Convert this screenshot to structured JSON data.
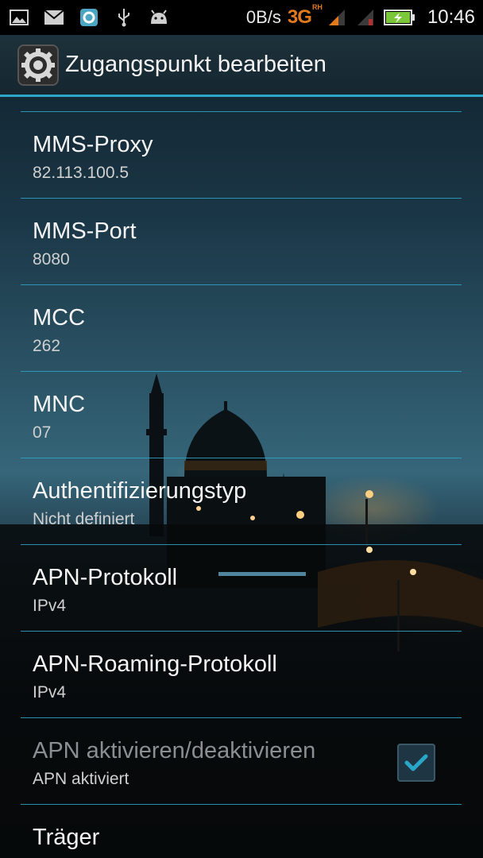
{
  "status_bar": {
    "icons": [
      "image-icon",
      "mail-icon",
      "app-icon",
      "usb-icon",
      "android-icon"
    ],
    "speed": "0B/s",
    "network": "3G",
    "network_sup": "RH",
    "time": "10:46",
    "battery_icon": "battery-charging-icon"
  },
  "action_bar": {
    "icon": "settings-gear-icon",
    "title": "Zugangspunkt bearbeiten"
  },
  "items": [
    {
      "title": "MMS-Proxy",
      "summary": "82.113.100.5"
    },
    {
      "title": "MMS-Port",
      "summary": "8080"
    },
    {
      "title": "MCC",
      "summary": "262"
    },
    {
      "title": "MNC",
      "summary": "07"
    },
    {
      "title": "Authentifizierungstyp",
      "summary": "Nicht definiert"
    },
    {
      "title": "APN-Protokoll",
      "summary": "IPv4"
    },
    {
      "title": "APN-Roaming-Protokoll",
      "summary": "IPv4"
    },
    {
      "title": "APN aktivieren/deaktivieren",
      "summary": "APN aktiviert",
      "checked": true,
      "enabled": false
    },
    {
      "title": "Träger"
    }
  ],
  "colors": {
    "accent": "#2aa6c9",
    "network_orange": "#e07a1c",
    "battery_green": "#7cc63a"
  }
}
